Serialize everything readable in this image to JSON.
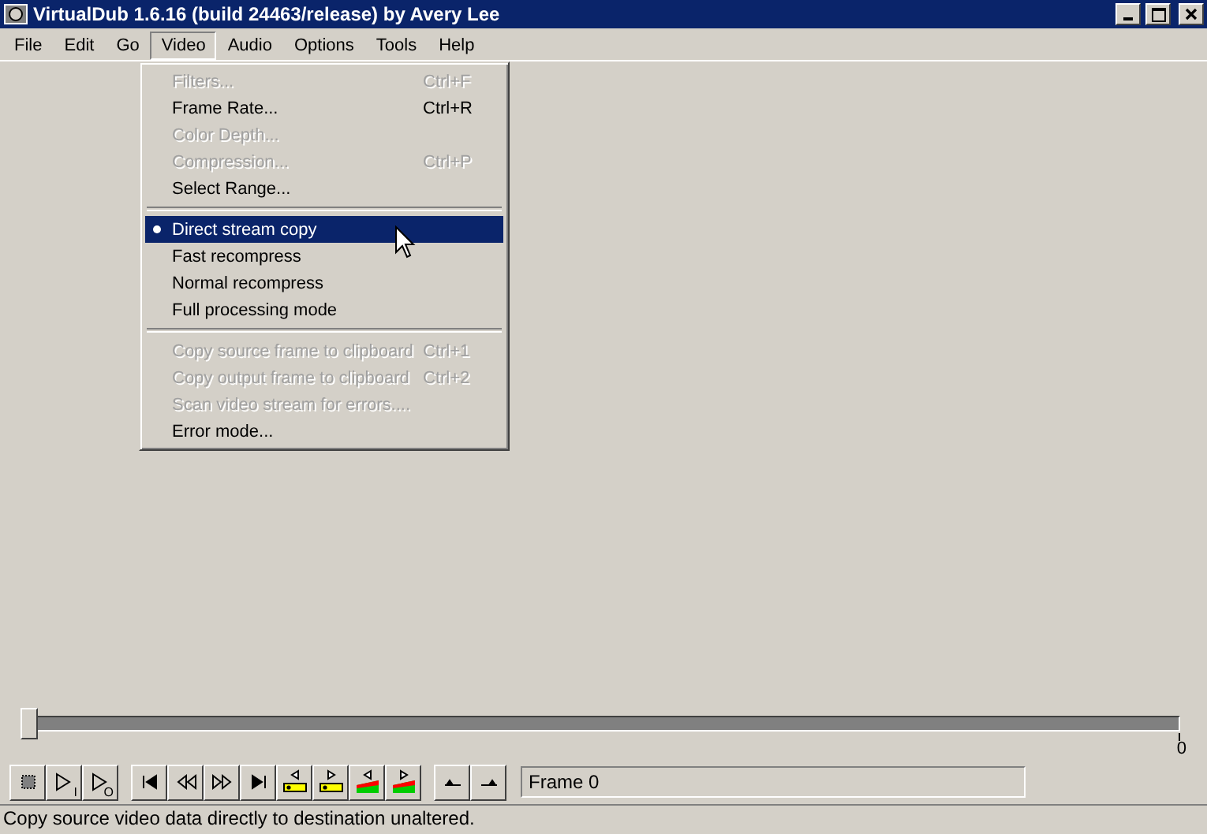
{
  "window": {
    "title": "VirtualDub 1.6.16 (build 24463/release) by Avery Lee"
  },
  "menu_bar": [
    {
      "label": "File",
      "selected": false
    },
    {
      "label": "Edit",
      "selected": false
    },
    {
      "label": "Go",
      "selected": false
    },
    {
      "label": "Video",
      "selected": true
    },
    {
      "label": "Audio",
      "selected": false
    },
    {
      "label": "Options",
      "selected": false
    },
    {
      "label": "Tools",
      "selected": false
    },
    {
      "label": "Help",
      "selected": false
    }
  ],
  "dropdown": [
    {
      "kind": "item",
      "label": "Filters...",
      "shortcut": "Ctrl+F",
      "disabled": true,
      "checked": false,
      "selected": false
    },
    {
      "kind": "item",
      "label": "Frame Rate...",
      "shortcut": "Ctrl+R",
      "disabled": false,
      "checked": false,
      "selected": false
    },
    {
      "kind": "item",
      "label": "Color Depth...",
      "disabled": true,
      "checked": false,
      "selected": false
    },
    {
      "kind": "item",
      "label": "Compression...",
      "shortcut": "Ctrl+P",
      "disabled": true,
      "checked": false,
      "selected": false
    },
    {
      "kind": "item",
      "label": "Select Range...",
      "disabled": false,
      "checked": false,
      "selected": false
    },
    {
      "kind": "separator"
    },
    {
      "kind": "item",
      "label": "Direct stream copy",
      "disabled": false,
      "checked": true,
      "selected": true
    },
    {
      "kind": "item",
      "label": "Fast recompress",
      "disabled": false,
      "checked": false,
      "selected": false
    },
    {
      "kind": "item",
      "label": "Normal recompress",
      "disabled": false,
      "checked": false,
      "selected": false
    },
    {
      "kind": "item",
      "label": "Full processing mode",
      "disabled": false,
      "checked": false,
      "selected": false
    },
    {
      "kind": "separator"
    },
    {
      "kind": "item",
      "label": "Copy source frame to clipboard",
      "shortcut": "Ctrl+1",
      "disabled": true,
      "checked": false,
      "selected": false
    },
    {
      "kind": "item",
      "label": "Copy output frame to clipboard",
      "shortcut": "Ctrl+2",
      "disabled": true,
      "checked": false,
      "selected": false
    },
    {
      "kind": "item",
      "label": "Scan video stream for errors....",
      "disabled": true,
      "checked": false,
      "selected": false
    },
    {
      "kind": "item",
      "label": "Error mode...",
      "disabled": false,
      "checked": false,
      "selected": false
    }
  ],
  "position_slider": {
    "level": 0,
    "end_label": "0"
  },
  "toolbar": [
    {
      "kind": "stop"
    },
    {
      "kind": "play",
      "label": "I"
    },
    {
      "kind": "play",
      "label": "O"
    },
    {
      "kind": "gap"
    },
    {
      "kind": "start"
    },
    {
      "kind": "back"
    },
    {
      "kind": "forward"
    },
    {
      "kind": "end"
    },
    {
      "kind": "key-prev"
    },
    {
      "kind": "key-next"
    },
    {
      "kind": "scene-prev"
    },
    {
      "kind": "scene-next"
    },
    {
      "kind": "gap"
    },
    {
      "kind": "mark-in"
    },
    {
      "kind": "mark-out"
    }
  ],
  "frame_field": {
    "value": "Frame 0"
  },
  "status_bar": {
    "text": "Copy source video data directly to destination unaltered."
  }
}
